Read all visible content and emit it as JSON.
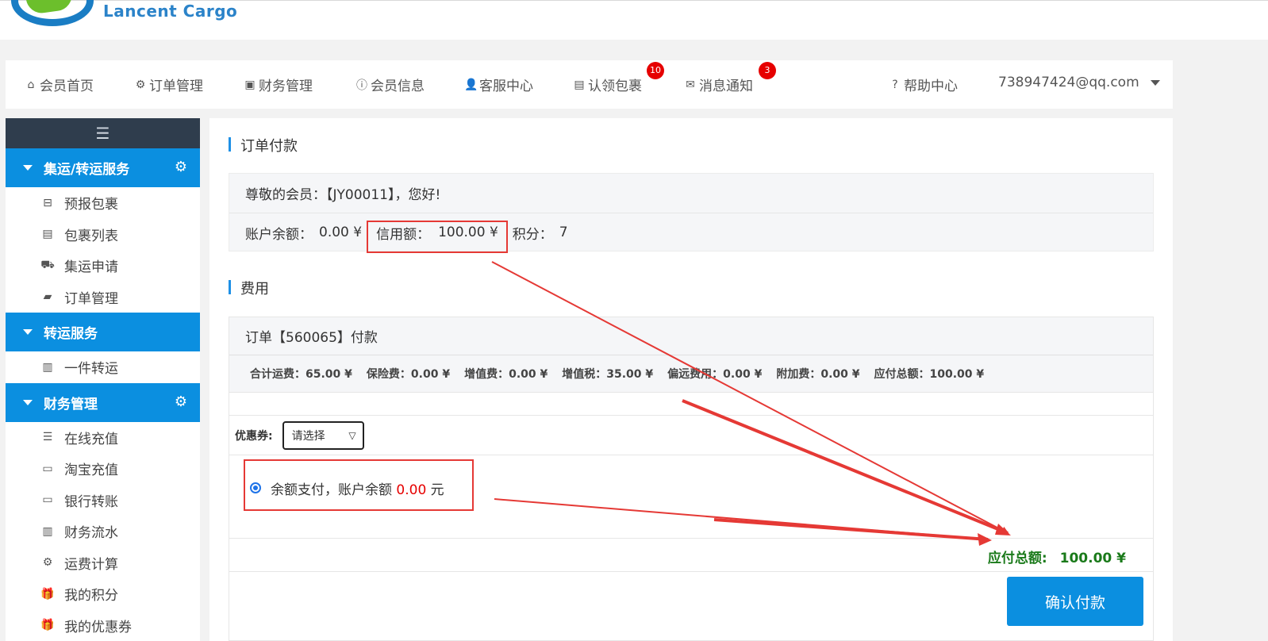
{
  "brand": {
    "logo_text": "Lancent Cargo"
  },
  "topnav": {
    "items": [
      {
        "icon": "home-icon",
        "label": "会员首页"
      },
      {
        "icon": "gear-icon",
        "label": "订单管理"
      },
      {
        "icon": "money-icon",
        "label": "财务管理"
      },
      {
        "icon": "info-icon",
        "label": "会员信息"
      },
      {
        "icon": "user-icon",
        "label": "客服中心"
      },
      {
        "icon": "archive-icon",
        "label": "认领包裹",
        "badge": "10"
      },
      {
        "icon": "envelope-icon",
        "label": "消息通知",
        "badge": "3"
      }
    ],
    "help": "帮助中心",
    "account": "738947424@qq.com"
  },
  "sidebar": {
    "groups": [
      {
        "title": "集运/转运服务",
        "items": [
          "预报包裹",
          "包裹列表",
          "集运申请",
          "订单管理"
        ]
      },
      {
        "title": "转运服务",
        "items": [
          "一件转运"
        ]
      },
      {
        "title": "财务管理",
        "items": [
          "在线充值",
          "淘宝充值",
          "银行转账",
          "财务流水",
          "运费计算",
          "我的积分",
          "我的优惠券"
        ]
      }
    ]
  },
  "main": {
    "order_title": "订单付款",
    "greeting": "尊敬的会员：【JY00011】，您好!",
    "balance_label": "账户余额：",
    "balance_value": "0.00 ¥",
    "credit_label": "信用额：",
    "credit_value": "100.00 ¥",
    "points_label": "积分：",
    "points_value": "7",
    "fee_title": "费用",
    "order_pay_title": "订单【560065】付款",
    "fees": [
      "合计运费：65.00 ¥",
      "保险费：0.00 ¥",
      "增值费：0.00 ¥",
      "增值税：35.00 ¥",
      "偏远费用：0.00 ¥",
      "附加费：0.00 ¥",
      "应付总额：100.00 ¥"
    ],
    "coupon_label": "优惠券:",
    "coupon_selected": "请选择",
    "pay_option_prefix": "余额支付，账户余额",
    "pay_option_amount": "0.00",
    "pay_option_suffix": "元",
    "total_label": "应付总额:",
    "total_value": "100.00 ¥",
    "confirm_button": "确认付款"
  },
  "colors": {
    "primary": "#0b8fe0",
    "badge": "#e60000",
    "total": "#1a7a1a",
    "annotation": "#e53935"
  }
}
